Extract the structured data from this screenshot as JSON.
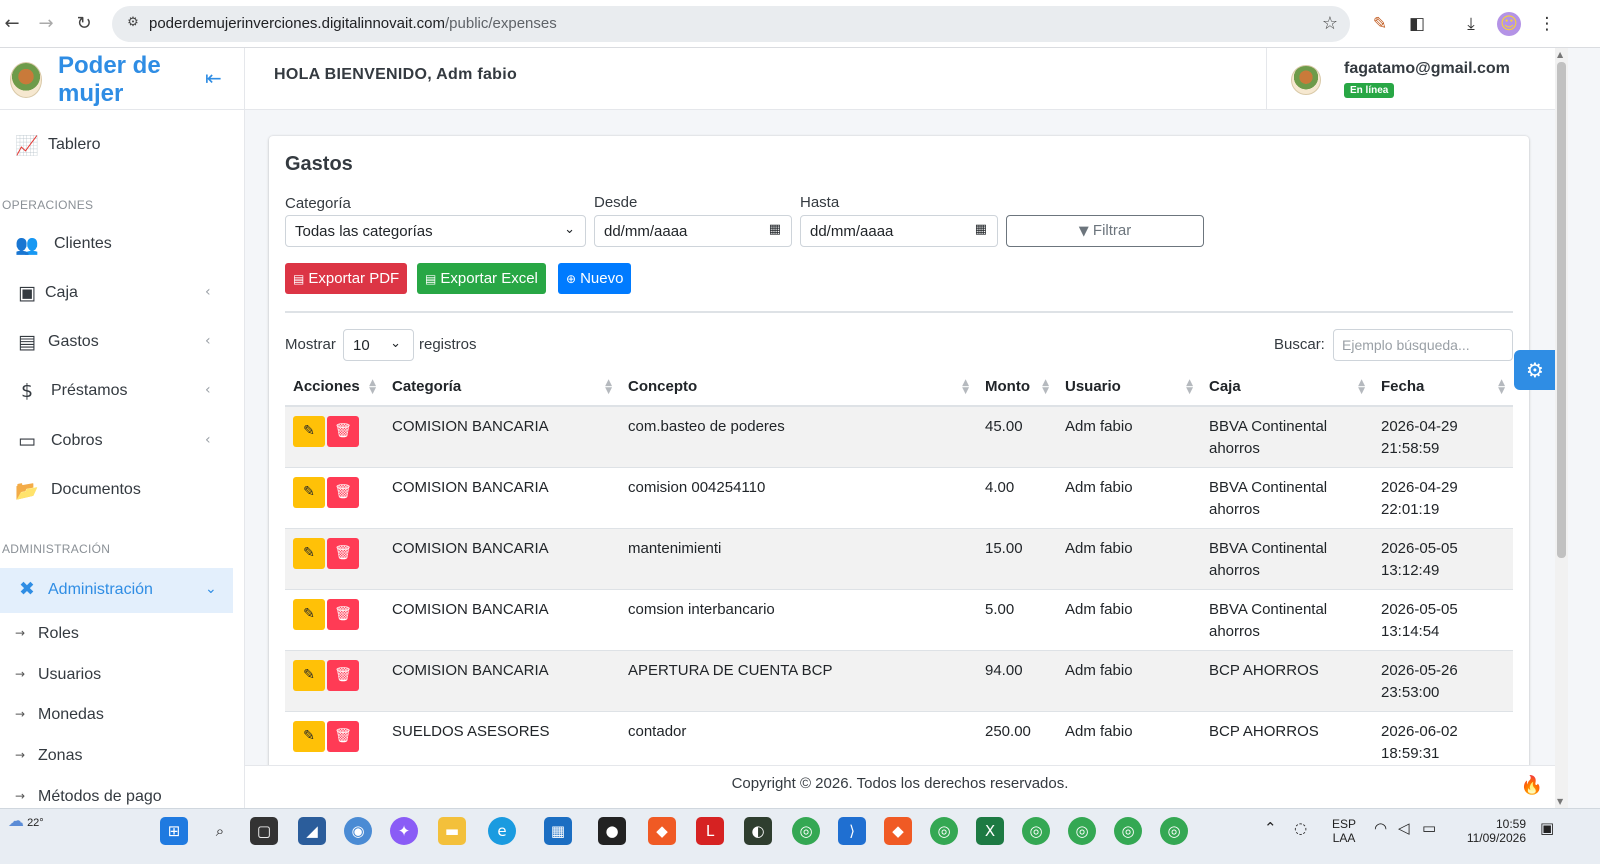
{
  "browser": {
    "url_domain": "poderdemujerinverciones.digitalinnovait.com",
    "url_path": "/public/expenses"
  },
  "sidebar": {
    "brand": "Poder de mujer",
    "items": [
      {
        "label": "Tablero",
        "icon": "chart-area-icon"
      },
      {
        "label": "Clientes",
        "icon": "users-icon"
      },
      {
        "label": "Caja",
        "icon": "box-icon"
      },
      {
        "label": "Gastos",
        "icon": "wallet-icon"
      },
      {
        "label": "Préstamos",
        "icon": "hand-holding-dollar-icon"
      },
      {
        "label": "Cobros",
        "icon": "credit-card-icon"
      },
      {
        "label": "Documentos",
        "icon": "folder-open-icon"
      },
      {
        "label": "Administración",
        "icon": "tools-icon"
      }
    ],
    "sections": {
      "operaciones": "OPERACIONES",
      "administracion": "ADMINISTRACIÓN"
    },
    "sub_items": [
      "Roles",
      "Usuarios",
      "Monedas",
      "Zonas",
      "Métodos de pago"
    ]
  },
  "header": {
    "welcome": "HOLA BIENVENIDO, Adm fabio",
    "email": "fagatamo@gmail.com",
    "status": "En línea"
  },
  "main": {
    "title": "Gastos",
    "filters": {
      "categoria_label": "Categoría",
      "categoria_value": "Todas las categorías",
      "desde_label": "Desde",
      "desde_value": "dd/mm/aaaa",
      "hasta_label": "Hasta",
      "hasta_value": "dd/mm/aaaa",
      "filter_button": "Filtrar"
    },
    "buttons": {
      "export_pdf": "Exportar PDF",
      "export_excel": "Exportar Excel",
      "new": "Nuevo"
    },
    "length": {
      "show_label": "Mostrar",
      "value": "10",
      "records_label": "registros"
    },
    "search": {
      "label": "Buscar:",
      "placeholder": "Ejemplo búsqueda..."
    },
    "table": {
      "columns": [
        "Acciones",
        "Categoría",
        "Concepto",
        "Monto",
        "Usuario",
        "Caja",
        "Fecha"
      ],
      "rows": [
        {
          "categoria": "COMISION BANCARIA",
          "concepto": "com.basteo de poderes",
          "monto": "45.00",
          "usuario": "Adm fabio",
          "caja": "BBVA Continental ahorros",
          "fecha": "2026-04-29 21:58:59"
        },
        {
          "categoria": "COMISION BANCARIA",
          "concepto": "comision 004254110",
          "monto": "4.00",
          "usuario": "Adm fabio",
          "caja": "BBVA Continental ahorros",
          "fecha": "2026-04-29 22:01:19"
        },
        {
          "categoria": "COMISION BANCARIA",
          "concepto": "mantenimienti",
          "monto": "15.00",
          "usuario": "Adm fabio",
          "caja": "BBVA Continental ahorros",
          "fecha": "2026-05-05 13:12:49"
        },
        {
          "categoria": "COMISION BANCARIA",
          "concepto": "comsion interbancario",
          "monto": "5.00",
          "usuario": "Adm fabio",
          "caja": "BBVA Continental ahorros",
          "fecha": "2026-05-05 13:14:54"
        },
        {
          "categoria": "COMISION BANCARIA",
          "concepto": "APERTURA DE CUENTA BCP",
          "monto": "94.00",
          "usuario": "Adm fabio",
          "caja": "BCP AHORROS",
          "fecha": "2026-05-26 23:53:00"
        },
        {
          "categoria": "SUELDOS ASESORES",
          "concepto": "contador",
          "monto": "250.00",
          "usuario": "Adm fabio",
          "caja": "BCP AHORROS",
          "fecha": "2026-06-02 18:59:31"
        }
      ]
    }
  },
  "footer": {
    "copyright": "Copyright © 2026. Todos los derechos reservados."
  },
  "taskbar": {
    "temperature": "22°",
    "language": "ESP",
    "layout": "LAA",
    "time": "10:59",
    "date": "11/09/2026"
  },
  "colors": {
    "primary": "#2f8de4",
    "danger": "#dc3545",
    "success": "#28a745",
    "warning": "#ffc107"
  }
}
